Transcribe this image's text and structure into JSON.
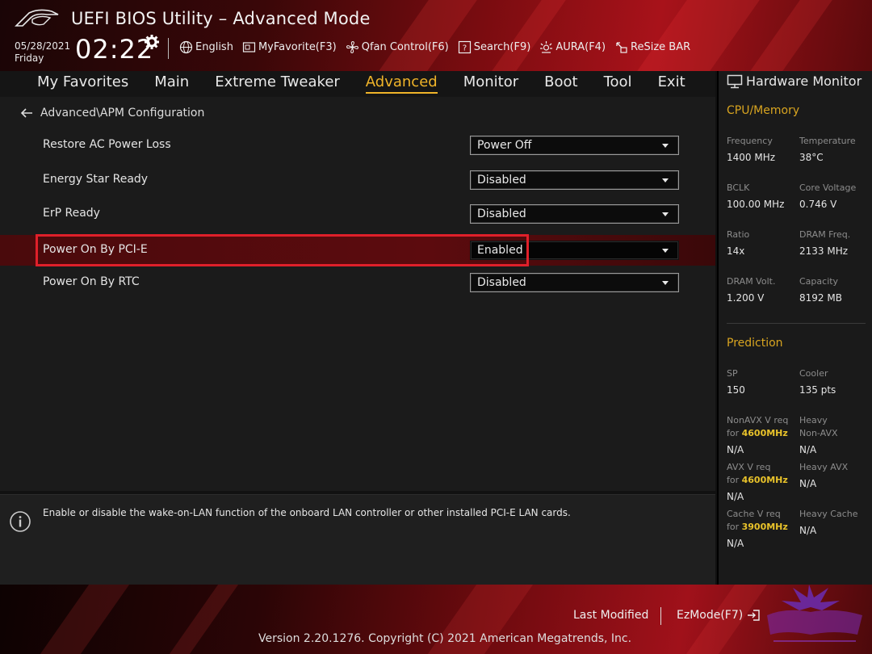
{
  "header": {
    "title": "UEFI BIOS Utility – Advanced Mode",
    "date": "05/28/2021",
    "day": "Friday",
    "time": "02:22",
    "toolbar": [
      {
        "label": "English",
        "icon": "globe-icon"
      },
      {
        "label": "MyFavorite(F3)",
        "icon": "favorite-icon"
      },
      {
        "label": "Qfan Control(F6)",
        "icon": "fan-icon"
      },
      {
        "label": "Search(F9)",
        "icon": "search-icon"
      },
      {
        "label": "AURA(F4)",
        "icon": "aura-icon"
      },
      {
        "label": "ReSize BAR",
        "icon": "resize-bar-icon"
      }
    ]
  },
  "nav": {
    "tabs": [
      "My Favorites",
      "Main",
      "Extreme Tweaker",
      "Advanced",
      "Monitor",
      "Boot",
      "Tool",
      "Exit"
    ],
    "active": "Advanced"
  },
  "main": {
    "breadcrumb": "Advanced\\APM Configuration",
    "settings": [
      {
        "label": "Restore AC Power Loss",
        "value": "Power Off"
      },
      {
        "label": "Energy Star Ready",
        "value": "Disabled"
      },
      {
        "label": "ErP Ready",
        "value": "Disabled"
      },
      {
        "label": "Power On By PCI-E",
        "value": "Enabled"
      },
      {
        "label": "Power On By RTC",
        "value": "Disabled"
      }
    ]
  },
  "help": {
    "text": "Enable or disable the wake-on-LAN function of the onboard LAN controller or other installed PCI-E LAN cards."
  },
  "hw_monitor": {
    "title": "Hardware Monitor",
    "cpu_memory": {
      "heading": "CPU/Memory",
      "frequency_label": "Frequency",
      "frequency": "1400 MHz",
      "temperature_label": "Temperature",
      "temperature": "38°C",
      "bclk_label": "BCLK",
      "bclk": "100.00 MHz",
      "core_voltage_label": "Core Voltage",
      "core_voltage": "0.746 V",
      "ratio_label": "Ratio",
      "ratio": "14x",
      "dram_freq_label": "DRAM Freq.",
      "dram_freq": "2133 MHz",
      "dram_volt_label": "DRAM Volt.",
      "dram_volt": "1.200 V",
      "capacity_label": "Capacity",
      "capacity": "8192 MB"
    },
    "prediction": {
      "heading": "Prediction",
      "sp_label": "SP",
      "sp": "150",
      "cooler_label": "Cooler",
      "cooler": "135 pts",
      "nonavx_label": "NonAVX V req",
      "for_label": "for",
      "nonavx_freq": "4600MHz",
      "nonavx_val": "N/A",
      "heavy_nonavx_label1": "Heavy",
      "heavy_nonavx_label2": "Non-AVX",
      "heavy_nonavx_val": "N/A",
      "avx_label": "AVX V req",
      "avx_freq": "4600MHz",
      "avx_val": "N/A",
      "heavy_avx_label": "Heavy AVX",
      "heavy_avx_val": "N/A",
      "cache_label": "Cache V req",
      "cache_freq": "3900MHz",
      "cache_val": "N/A",
      "heavy_cache_label": "Heavy Cache",
      "heavy_cache_val": "N/A"
    }
  },
  "footer": {
    "last_modified": "Last Modified",
    "ezmode": "EzMode(F7)",
    "version": "Version 2.20.1276. Copyright (C) 2021 American Megatrends, Inc."
  },
  "colors": {
    "accent_gold": "#f0b429",
    "highlight_red": "#e0202a",
    "brand_red": "#a8121a"
  }
}
